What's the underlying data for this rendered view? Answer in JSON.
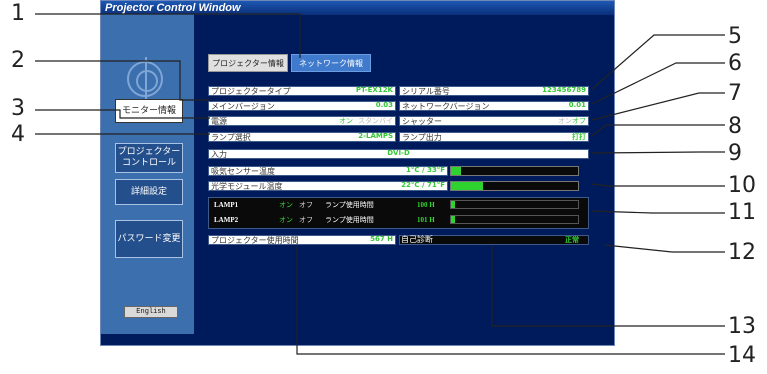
{
  "window": {
    "title": "Projector Control Window"
  },
  "sidebar": {
    "items": [
      {
        "label": "モニター情報"
      },
      {
        "label": "プロジェクター\nコントロール"
      },
      {
        "label": "詳細設定"
      },
      {
        "label": "パスワード変更"
      }
    ],
    "english": "English"
  },
  "tabs": [
    {
      "label": "プロジェクター情報"
    },
    {
      "label": "ネットワーク情報"
    }
  ],
  "info": {
    "type_label": "プロジェクタータイプ",
    "type_value": "PT-EX12K",
    "serial_label": "シリアル番号",
    "serial_value": "123456789",
    "main_ver_label": "メインバージョン",
    "main_ver_value": "0.03",
    "net_ver_label": "ネットワークバージョン",
    "net_ver_value": "0.01",
    "power_label": "電源",
    "power_on": "オン",
    "power_standby": "スタンバイ",
    "shutter_label": "シャッター",
    "shutter_on": "オン",
    "shutter_off": "オフ",
    "lamp_select_label": "ランプ選択",
    "lamp_select_value": "2-LAMPS",
    "lamp_output_label": "ランプ出力",
    "lamp_output_value": "打打",
    "input_label": "入力",
    "input_value": "DVI-D",
    "intake_label": "吸気センサー温度",
    "intake_value": "1°C / 33°F",
    "optical_label": "光学モジュール温度",
    "optical_value": "22°C / 71°F",
    "usage_label": "プロジェクター使用時間",
    "usage_value": "567 H",
    "diag_label": "自己診断",
    "diag_value": "正常"
  },
  "bars": {
    "intake_fraction": 0.08,
    "optical_fraction": 0.25,
    "lamp1_fraction": 0.03,
    "lamp2_fraction": 0.03
  },
  "lamps": [
    {
      "name": "LAMP1",
      "on": "オン",
      "off": "オフ",
      "hours_label": "ランプ使用時間",
      "hours": "100 H"
    },
    {
      "name": "LAMP2",
      "on": "オン",
      "off": "オフ",
      "hours_label": "ランプ使用時間",
      "hours": "101 H"
    }
  ],
  "callouts": [
    "1",
    "2",
    "3",
    "4",
    "5",
    "6",
    "7",
    "8",
    "9",
    "10",
    "11",
    "12",
    "13",
    "14"
  ]
}
